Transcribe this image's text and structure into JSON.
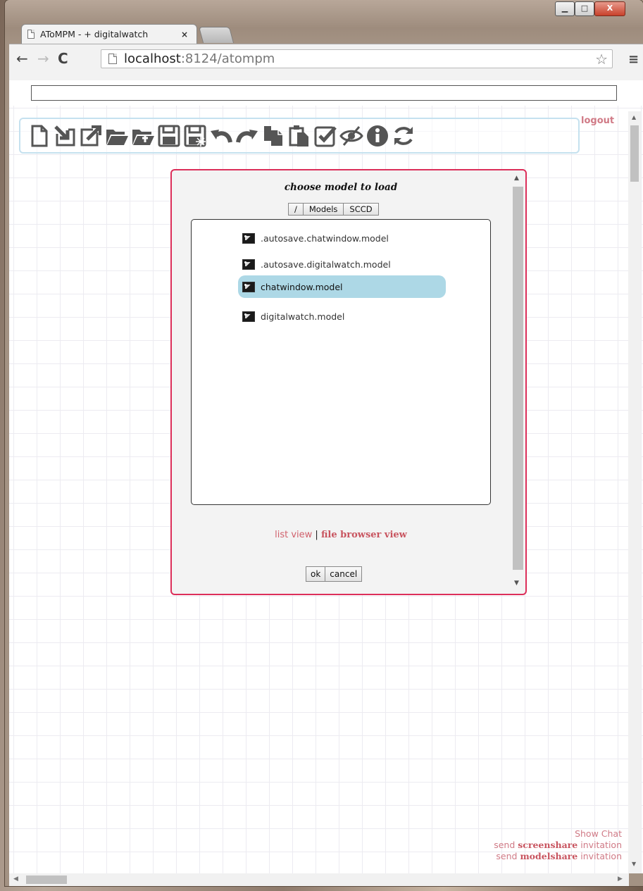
{
  "window": {
    "min_label": "▁",
    "max_label": "□",
    "close_label": "X"
  },
  "tab": {
    "title": "AToMPM - + digitalwatch",
    "close_label": "×"
  },
  "address_bar": {
    "host": "localhost",
    "path": ":8124/atompm"
  },
  "toolbar": {
    "icons": [
      "new-file-icon",
      "import-icon",
      "export-icon",
      "open-folder-icon",
      "new-folder-icon",
      "save-icon",
      "save-as-icon",
      "undo-icon",
      "redo-icon",
      "copy-icon",
      "paste-icon",
      "validate-icon",
      "hide-icon",
      "info-icon",
      "refresh-icon"
    ]
  },
  "logout_label": "logout",
  "dialog": {
    "title": "choose model to load",
    "path_buttons": [
      "/",
      "Models",
      "SCCD"
    ],
    "files": [
      ".autosave.chatwindow.model",
      ".autosave.digitalwatch.model",
      "chatwindow.model",
      "digitalwatch.model"
    ],
    "selected_index": 2,
    "view_list_label": "list view",
    "view_separator": "|",
    "view_file_label": "file browser view",
    "ok_label": "ok",
    "cancel_label": "cancel"
  },
  "footer": {
    "show_chat": "Show Chat",
    "send_prefix": "send",
    "screenshare_label": "screenshare",
    "modelshare_label": "modelshare",
    "invitation_suffix": "invitation"
  },
  "colors": {
    "accent_link": "#d07a86",
    "dialog_border": "#dc2f5a",
    "selection": "#add8e6",
    "toolbar_border": "#c5e1ef"
  }
}
